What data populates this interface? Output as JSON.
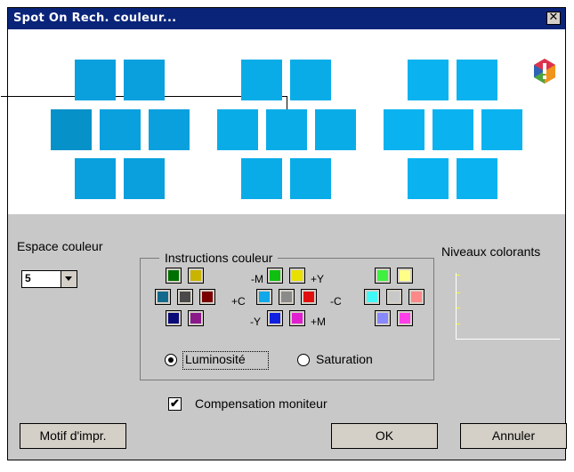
{
  "window": {
    "title": "Spot On Rech. couleur...",
    "close_glyph": "✕"
  },
  "colors": {
    "title_bg": "#0a247a",
    "patch_left": "#0aa0de",
    "patch_left_dark": "#0791c9",
    "patch_mid": "#0aace8",
    "patch_right": "#0ab3f0",
    "warning_red": "#e0314a",
    "warning_orange": "#f1941a",
    "warning_green": "#4aa53e",
    "warning_blue": "#2e62b5"
  },
  "warning_icon": "gamut-warning-icon",
  "color_space": {
    "label": "Espace couleur",
    "selected": "5"
  },
  "instructions": {
    "title": "Instructions couleur",
    "labels": {
      "minus_m": "-M",
      "plus_y": "+Y",
      "plus_c": "+C",
      "minus_c": "-C",
      "minus_y": "-Y",
      "plus_m": "+M"
    },
    "swatches": {
      "left": [
        "#007000",
        "#c9b400",
        "#146a8c",
        "#4a4a4a",
        "#7a0000",
        "#0a0a78",
        "#8a1a8a"
      ],
      "mid": [
        "#10c010",
        "#e8e000",
        "#10a8e8",
        "#8a8a8a",
        "#e01010",
        "#1020e0",
        "#e020d0"
      ],
      "right": [
        "#40f040",
        "#ffff88",
        "#40f8f8",
        "#c8c8c8",
        "#ff8888",
        "#8888ff",
        "#ff40e8"
      ]
    },
    "luminosity": "Luminosité",
    "saturation": "Saturation",
    "selected_mode": "Luminosité"
  },
  "levels": {
    "label": "Niveaux colorants"
  },
  "monitor": {
    "label": "Compensation moniteur",
    "checked": true,
    "check_glyph": "✔"
  },
  "buttons": {
    "print_pattern": "Motif d'impr.",
    "ok": "OK",
    "cancel": "Annuler"
  }
}
